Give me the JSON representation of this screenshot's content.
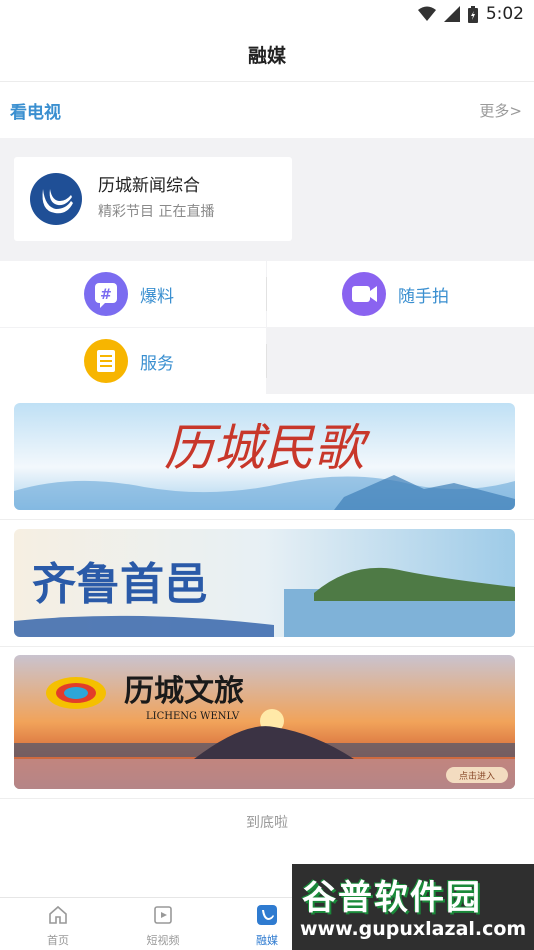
{
  "status_bar": {
    "time": "5:02",
    "icons": [
      "wifi-icon",
      "signal-icon",
      "battery-icon"
    ]
  },
  "header": {
    "title": "融媒"
  },
  "tv_section": {
    "label": "看电视",
    "more": "更多>"
  },
  "channel": {
    "name": "历城新闻综合",
    "status": "精彩节目  正在直播",
    "icon": "channel-logo-icon"
  },
  "features": [
    {
      "label": "爆料",
      "icon": "hashtag-icon",
      "color": "#7b6cf0"
    },
    {
      "label": "随手拍",
      "icon": "video-camera-icon",
      "color": "#8a63f0"
    },
    {
      "label": "服务",
      "icon": "document-icon",
      "color": "#f7b500"
    }
  ],
  "banners": [
    {
      "title": "历城民歌"
    },
    {
      "title": "齐鲁首邑"
    },
    {
      "title": "历城文旅",
      "subtitle": "LICHENG WENLV",
      "badge": "点击进入"
    }
  ],
  "footer_note": "到底啦",
  "tabs": [
    {
      "label": "首页",
      "icon": "home-icon"
    },
    {
      "label": "短视频",
      "icon": "video-icon"
    },
    {
      "label": "融媒",
      "icon": "media-icon",
      "active": true
    }
  ],
  "watermark": {
    "text": "谷普软件园",
    "url": "www.gupuxlazal.com"
  },
  "colors": {
    "accent": "#3a8fd0",
    "active_tab": "#2f7bd0",
    "background": "#f2f2f4"
  }
}
